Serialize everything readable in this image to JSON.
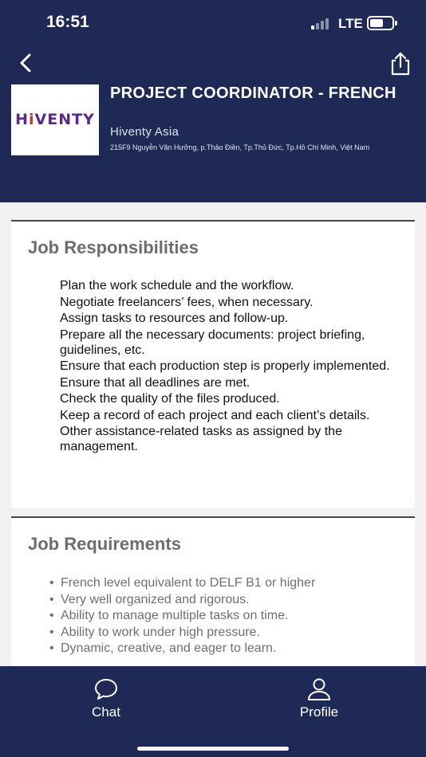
{
  "status_bar": {
    "time": "16:51",
    "network": "LTE"
  },
  "header": {
    "back_icon": "chevron-left-icon",
    "share_icon": "share-icon",
    "logo_text": "HiVENTY",
    "job_title": "PROJECT COORDINATOR - FRENCH",
    "company": "Hiventy Asia",
    "address": "215F9 Nguyễn Văn Hưởng, p.Thảo Điền, Tp.Thủ Đức, Tp.Hồ Chí Minh, Việt Nam"
  },
  "responsibilities": {
    "heading": "Job Responsibilities",
    "items": [
      "Plan the work schedule and the workflow.",
      "Negotiate freelancers’ fees, when necessary.",
      "Assign tasks to resources and follow-up.",
      "Prepare all the necessary documents: project briefing, guidelines, etc.",
      "Ensure that each production step is properly implemented.",
      "Ensure that all deadlines are met.",
      "Check the quality of the files produced.",
      "Keep a record of each project and each client’s details.",
      "Other assistance-related tasks as assigned by the management."
    ]
  },
  "requirements": {
    "heading": "Job Requirements",
    "items": [
      "French level equivalent to DELF B1 or higher",
      "Very well organized and rigorous.",
      "Ability to manage multiple tasks on time.",
      "Ability to work under high pressure.",
      "Dynamic, creative, and eager to learn."
    ]
  },
  "tabbar": {
    "tabs": [
      {
        "label": "Chat",
        "icon": "chat-bubble-icon"
      },
      {
        "label": "Profile",
        "icon": "user-icon"
      }
    ]
  },
  "colors": {
    "header_bg": "#1e2a55",
    "page_bg": "#f3f1f1",
    "heading_gray": "#6d6d6d"
  }
}
